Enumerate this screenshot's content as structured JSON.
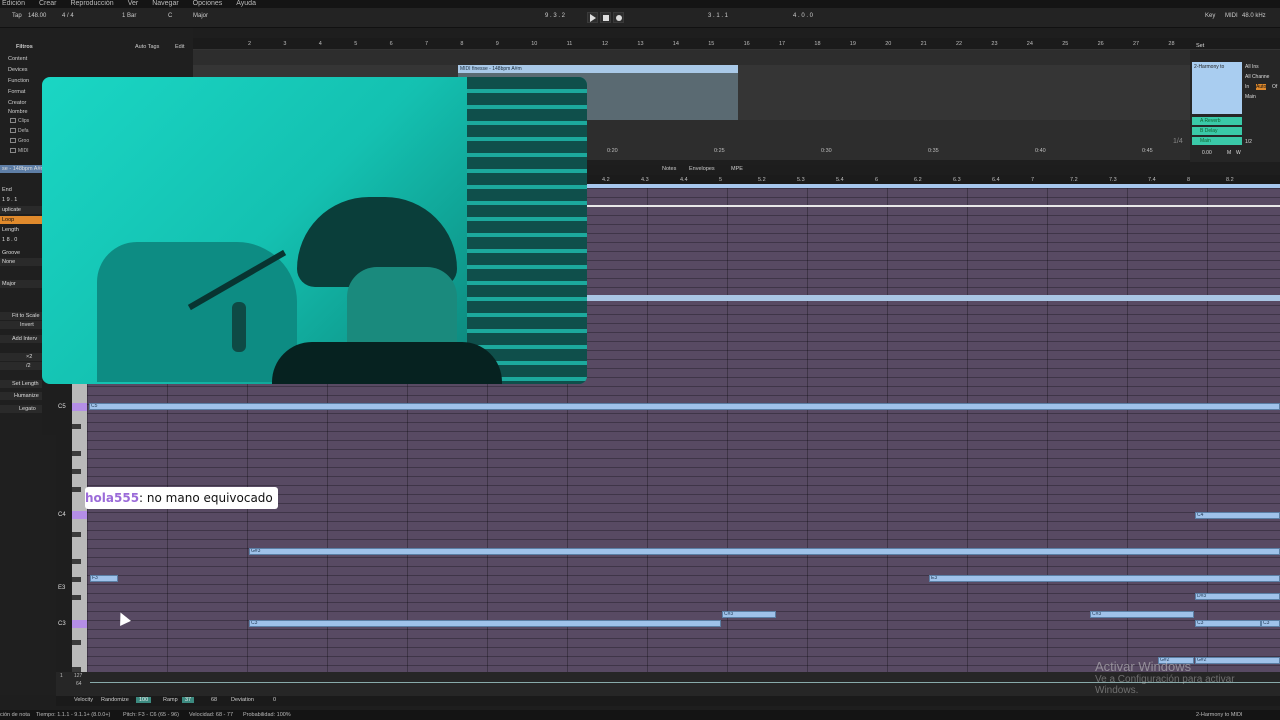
{
  "menu": [
    "Edición",
    "Crear",
    "Reproducción",
    "Ver",
    "Navegar",
    "Opciones",
    "Ayuda"
  ],
  "transport": {
    "tap": "Tap",
    "tempo": "148.00",
    "signature": "4 / 4",
    "metro": "1 Bar",
    "key": "C",
    "scale": "Major",
    "position": "9 . 3 . 2",
    "loop_start": "3 . 1 . 1",
    "loop_length": "4 . 0 . 0",
    "key_label": "Key",
    "midi_label": "MIDI",
    "sample_rate": "48.0 kHz"
  },
  "browser": {
    "filters_label": "Filtros",
    "auto_tags": "Auto Tags",
    "edit": "Edit",
    "filters": [
      "Content",
      "Devices",
      "Function",
      "Format",
      "Creator"
    ],
    "name_header": "Nombre",
    "folders": [
      "Clips",
      "Defa",
      "Groo",
      "MIDI"
    ]
  },
  "clip_props": {
    "clip_name": "se - 148bpm A#m",
    "end_label": "End",
    "end_val": "1 9 . 1",
    "duplicate": "uplicate",
    "loop": "Loop",
    "length_label": "Length",
    "length_val": "1 8 . 0",
    "groove_label": "Groove",
    "groove_val": "None",
    "scale_val": "Major",
    "fit_to_scale": "Fit to Scale",
    "invert": "Invert",
    "add_interval": "Add Interv",
    "mult": "×2",
    "div": "/2",
    "set_length": "Set Length",
    "humanize": "Humanize",
    "legato": "Legato"
  },
  "arrangement": {
    "ruler": [
      "2",
      "3",
      "4",
      "5",
      "6",
      "7",
      "8",
      "9",
      "10",
      "11",
      "12",
      "13",
      "14",
      "15",
      "16",
      "17",
      "18",
      "19",
      "20",
      "21",
      "22",
      "23",
      "24",
      "25",
      "26",
      "27",
      "28"
    ],
    "clip_title": "MIDI finesse - 148bpm A#m",
    "time_ruler": [
      "0:20",
      "0:25",
      "0:30",
      "0:35",
      "0:40",
      "0:45"
    ],
    "page": "1/4"
  },
  "mixer": {
    "track_name": "2-Harmony to",
    "set_label": "Set",
    "input": "All Ins",
    "channel": "All Channe",
    "monitor": [
      "In",
      "Auto",
      "Of"
    ],
    "output": "Main",
    "sends": [
      "A Reverb",
      "B Delay",
      "Main"
    ],
    "half": "1/2",
    "vol": "0.00",
    "m_btn": "M",
    "w_btn": "W"
  },
  "piano_roll": {
    "tabs": [
      "Notes",
      "Envelopes",
      "MPE"
    ],
    "ruler": [
      "4.2",
      "4.3",
      "4.4",
      "5",
      "5.2",
      "5.3",
      "5.4",
      "6",
      "6.2",
      "6.3",
      "6.4",
      "7",
      "7.2",
      "7.3",
      "7.4",
      "8",
      "8.2"
    ],
    "octave_labels": [
      "C5",
      "C4",
      "E3",
      "C3"
    ],
    "notes": [
      "C5",
      "G#3",
      "F3",
      "E3",
      "C#3",
      "C3",
      "C#3",
      "C4",
      "D#3",
      "C3",
      "C3",
      "G#2",
      "G#2"
    ]
  },
  "velocity": {
    "max": "127",
    "mid": "64",
    "one": "1"
  },
  "bottom_bar": {
    "velocity": "Velocity",
    "randomize": "Randomize",
    "randomize_val": "100",
    "ramp": "Ramp",
    "ramp_val": "37",
    "ramp_val2": "68",
    "deviation": "Deviation",
    "deviation_val": "0"
  },
  "status": {
    "left": "ción de nota",
    "time": "Tiempo: 1.1.1 - 9.1.1+ (8.0.0+)",
    "pitch": "Pitch: F3 - C6 (65 - 96)",
    "velocity": "Velocidad: 68 - 77",
    "probability": "Probabilidad: 100%",
    "track": "2-Harmony to MIDI"
  },
  "chat": {
    "user": "hola555",
    "message": " : no mano equivocado"
  },
  "windows": {
    "title": "Activar Windows",
    "subtitle": "Ve a Configuración para activar Windows."
  }
}
